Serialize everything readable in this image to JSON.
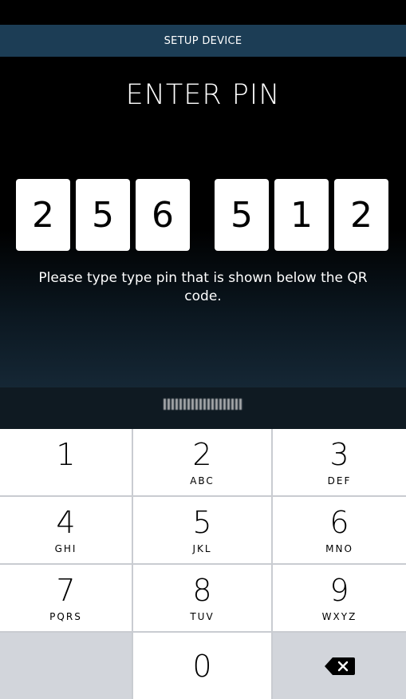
{
  "header": {
    "title": "SETUP DEVICE"
  },
  "main": {
    "title": "ENTER PIN",
    "pin_digits": [
      "2",
      "5",
      "6",
      "5",
      "1",
      "2"
    ],
    "instruction": "Please type type pin that is shown below the QR code."
  },
  "keypad": {
    "keys": [
      {
        "digit": "1",
        "letters": ""
      },
      {
        "digit": "2",
        "letters": "ABC"
      },
      {
        "digit": "3",
        "letters": "DEF"
      },
      {
        "digit": "4",
        "letters": "GHI"
      },
      {
        "digit": "5",
        "letters": "JKL"
      },
      {
        "digit": "6",
        "letters": "MNO"
      },
      {
        "digit": "7",
        "letters": "PQRS"
      },
      {
        "digit": "8",
        "letters": "TUV"
      },
      {
        "digit": "9",
        "letters": "WXYZ"
      },
      {
        "digit": "0",
        "letters": ""
      }
    ],
    "backspace_icon": "backspace-icon"
  }
}
